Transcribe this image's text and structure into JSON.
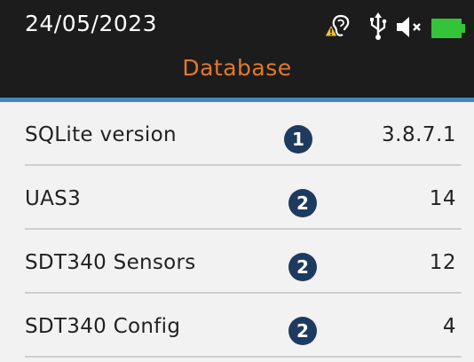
{
  "status_bar": {
    "date": "24/05/2023",
    "icons": [
      "warning-hearing-icon",
      "usb-icon",
      "speaker-muted-icon",
      "battery-icon"
    ],
    "battery_level": 1.0
  },
  "header": {
    "title": "Database"
  },
  "colors": {
    "header_bg": "#1c1c1c",
    "title": "#e3782b",
    "accent_line": "#3f88c5",
    "badge": "#1f3a5f",
    "battery": "#35c437"
  },
  "rows": [
    {
      "label": "SQLite version",
      "badge": "1",
      "value": "3.8.7.1"
    },
    {
      "label": "UAS3",
      "badge": "2",
      "value": "14"
    },
    {
      "label": "SDT340 Sensors",
      "badge": "2",
      "value": "12"
    },
    {
      "label": "SDT340 Config",
      "badge": "2",
      "value": "4"
    }
  ]
}
